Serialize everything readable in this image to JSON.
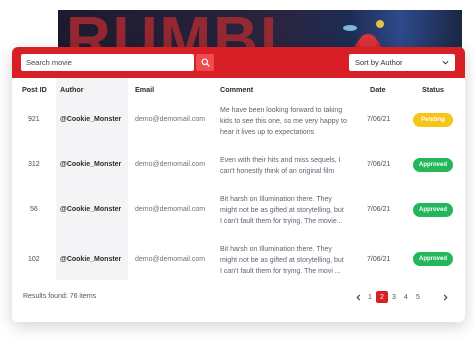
{
  "poster": {
    "title": "RUMBL"
  },
  "toolbar": {
    "search_placeholder": "Search movie",
    "sort_label": "Sort by Author"
  },
  "table": {
    "headers": {
      "post_id": "Post ID",
      "author": "Author",
      "email": "Email",
      "comment": "Comment",
      "date": "Date",
      "status": "Status"
    },
    "rows": [
      {
        "post_id": "921",
        "author": "@Cookie_Monster",
        "email": "demo@demomail.com",
        "comment": [
          "Me have been looking forward to taking",
          "kids to see this one, so me very happy to",
          "hear it lives up to expectations"
        ],
        "date": "7/06/21",
        "status": "Pending"
      },
      {
        "post_id": "312",
        "author": "@Cookie_Monster",
        "email": "demo@demomail.com",
        "comment": [
          "Even with their hits and miss sequels, I",
          "can't honestly think of an original film"
        ],
        "date": "7/06/21",
        "status": "Approved"
      },
      {
        "post_id": "56",
        "author": "@Cookie_Monster",
        "email": "demo@demomail.com",
        "comment": [
          "Bit harsh on Illumination there. They",
          "might not be as gifted at storytelling, but",
          "I can't fault them for trying. The movie..."
        ],
        "date": "7/06/21",
        "status": "Approved"
      },
      {
        "post_id": "102",
        "author": "@Cookie_Monster",
        "email": "demo@demomail.com",
        "comment": [
          "Bit harsh on Illumination there. They",
          "might not be as gifted at storytelling, but",
          "I can't fault them for trying. The movi ..."
        ],
        "date": "7/06/21",
        "status": "Approved"
      }
    ]
  },
  "footer": {
    "results": "Results found: 76 items",
    "pages": [
      "1",
      "2",
      "3",
      "4",
      "5"
    ],
    "active_page": "2",
    "prev_icon": "chevron-left-icon",
    "next_icon": "chevron-right-icon"
  },
  "colors": {
    "accent": "#d81f25",
    "pending": "#f5c518",
    "approved": "#23b65a"
  }
}
